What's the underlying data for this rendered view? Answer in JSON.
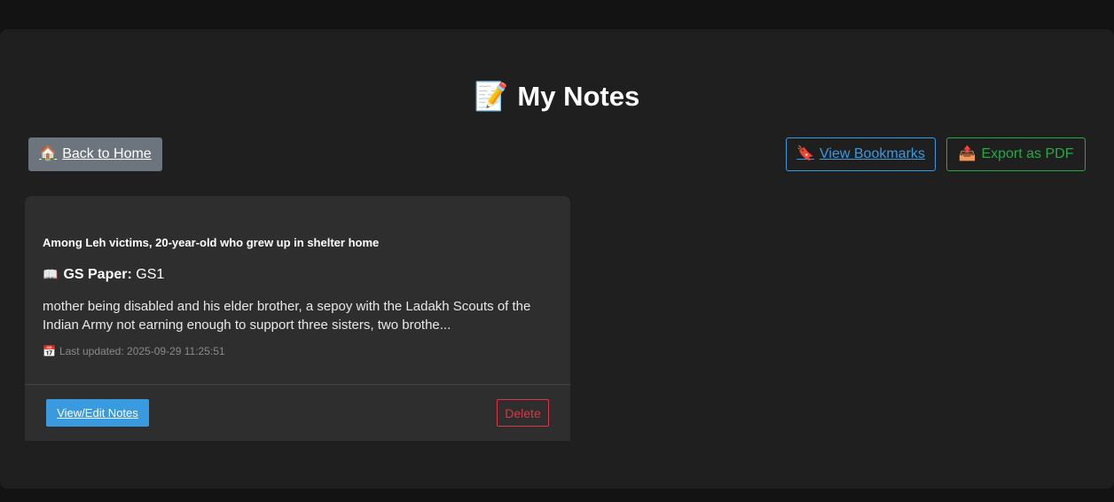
{
  "page": {
    "title": "My Notes",
    "title_icon": "📝"
  },
  "toolbar": {
    "back_home": {
      "label": "Back to Home",
      "icon": "🏠"
    },
    "view_bookmarks": {
      "label": "View Bookmarks",
      "icon": "🔖"
    },
    "export_pdf": {
      "label": "Export as PDF",
      "icon": "📤"
    }
  },
  "notes": [
    {
      "title": "Among Leh victims, 20-year-old who grew up in shelter home",
      "paper_icon": "📖",
      "paper_label": "GS Paper:",
      "paper_value": "GS1",
      "excerpt": "mother being disabled and his elder brother, a sepoy with the Ladakh Scouts of the Indian Army not earning enough to support three sisters, two brothe...",
      "updated_icon": "📅",
      "updated_text": "Last updated: 2025-09-29 11:25:51",
      "view_label": "View/Edit Notes",
      "delete_label": "Delete"
    }
  ],
  "colors": {
    "background": "#131313",
    "panel": "#1f1f1f",
    "card": "#2e2e2e",
    "primary": "#3a9ae0",
    "success": "#28a745",
    "danger": "#dc3545",
    "secondary": "#6c757d"
  }
}
